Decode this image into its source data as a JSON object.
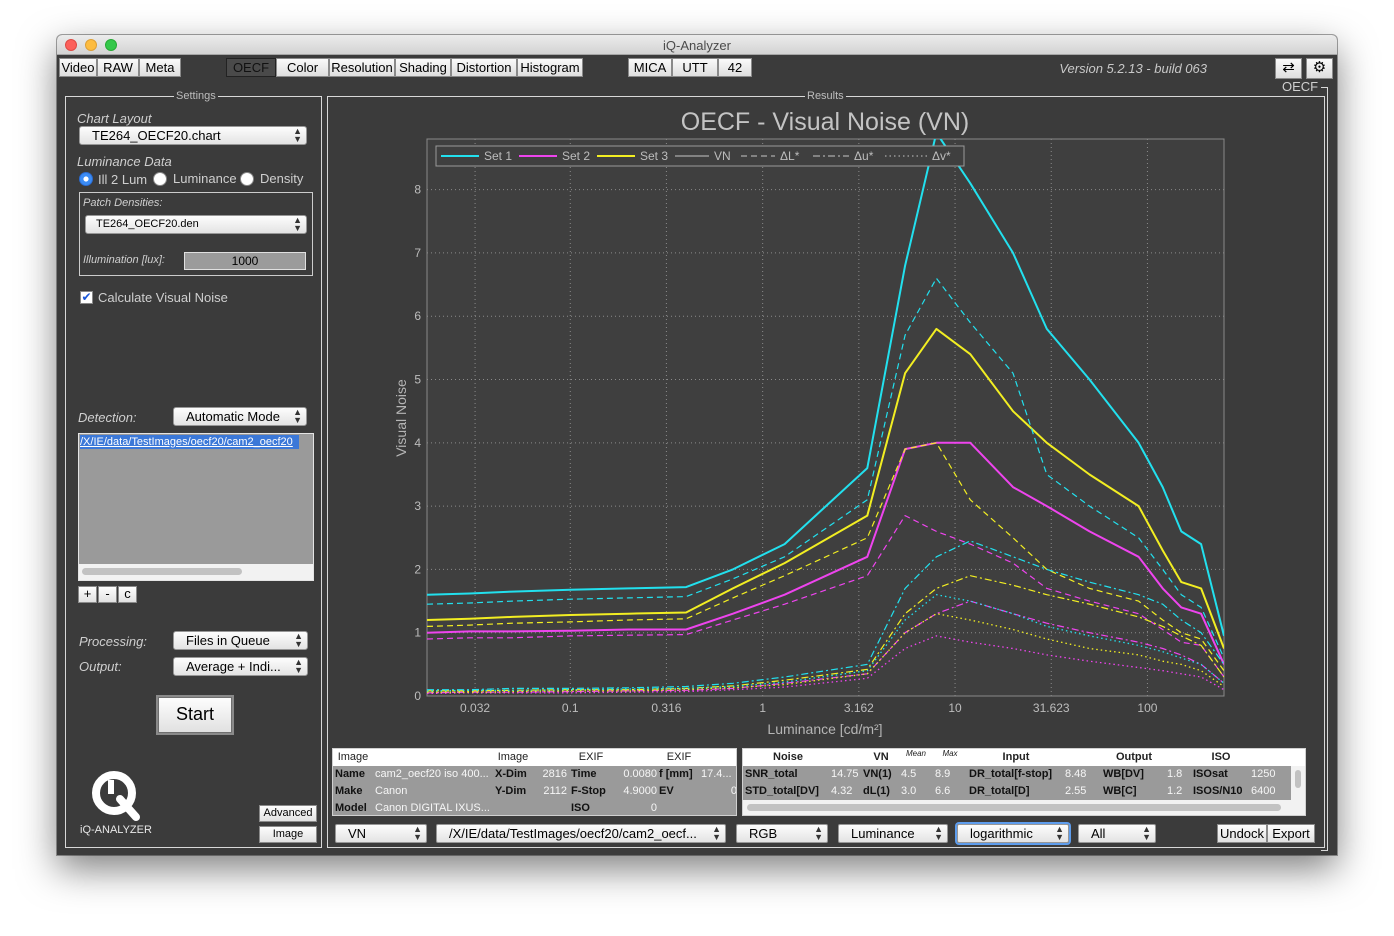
{
  "window": {
    "title": "iQ-Analyzer",
    "version": "Version 5.2.13 - build 063"
  },
  "toolbar": {
    "left_tabs": [
      "Video",
      "RAW",
      "Meta"
    ],
    "mode_tabs": [
      "OECF",
      "Color",
      "Resolution",
      "Shading",
      "Distortion",
      "Histogram"
    ],
    "extra_tabs": [
      "MICA",
      "UTT",
      "42"
    ],
    "active_tab": "OECF",
    "swap_icon": "swap-arrows-icon",
    "settings_icon": "gear-icon"
  },
  "settings": {
    "panel_title": "Settings",
    "chart_layout_label": "Chart Layout",
    "chart_layout_value": "TE264_OECF20.chart",
    "luminance_data_label": "Luminance Data",
    "radio_options": [
      "Ill 2 Lum",
      "Luminance",
      "Density"
    ],
    "radio_selected": "Ill 2 Lum",
    "patch_densities_label": "Patch Densities:",
    "patch_densities_value": "TE264_OECF20.den",
    "illumination_label": "Illumination [lux]:",
    "illumination_value": "1000",
    "calc_visual_noise_label": "Calculate Visual Noise",
    "calc_visual_noise_checked": true,
    "detection_label": "Detection:",
    "detection_value": "Automatic Mode",
    "file_list": [
      "/X/IE/data/TestImages/oecf20/cam2_oecf20"
    ],
    "list_buttons": [
      "+",
      "-",
      "c"
    ],
    "processing_label": "Processing:",
    "processing_value": "Files in Queue",
    "output_label": "Output:",
    "output_value": "Average + Indi...",
    "start_label": "Start",
    "logo_text": "iQ-ANALYZER",
    "advanced_label": "Advanced",
    "image_label": "Image"
  },
  "results": {
    "panel_title": "Results",
    "section_label": "OECF",
    "undock_label": "Undock",
    "export_label": "Export",
    "bottom_selects": [
      "VN",
      "/X/IE/data/TestImages/oecf20/cam2_oecf...",
      "RGB",
      "Luminance",
      "logarithmic",
      "All"
    ]
  },
  "image_table": {
    "headers": [
      "Image",
      "Image",
      "EXIF",
      "EXIF"
    ],
    "rows": [
      [
        "Name",
        "cam2_oecf20 iso 400...",
        "X-Dim",
        "2816",
        "Time",
        "0.0080",
        "f [mm]",
        "17.4..."
      ],
      [
        "Make",
        "Canon",
        "Y-Dim",
        "2112",
        "F-Stop",
        "4.9000",
        "EV",
        "0"
      ],
      [
        "Model",
        "Canon DIGITAL IXUS...",
        "",
        "",
        "ISO",
        "0",
        "",
        ""
      ]
    ]
  },
  "noise_table": {
    "headers": [
      "Noise",
      "VN",
      "Mean",
      "Max",
      "Input",
      "Output",
      "ISO"
    ],
    "rows": [
      [
        "SNR_total",
        "14.75",
        "VN(1)",
        "4.5",
        "8.9",
        "DR_total[f-stop]",
        "8.48",
        "WB[DV]",
        "1.8",
        "ISOsat",
        "1250"
      ],
      [
        "STD_total[DV]",
        "4.32",
        "dL(1)",
        "3.0",
        "6.6",
        "DR_total[D]",
        "2.55",
        "WB[C]",
        "1.2",
        "ISOS/N10",
        "6400"
      ]
    ]
  },
  "colors": {
    "set1": "#22e0ee",
    "set2": "#ee44ee",
    "set3": "#f2ee22",
    "plot_bg": "#3f3f3f",
    "axis_text": "#bdbdbd",
    "title": "#c4c4c4"
  },
  "chart_data": {
    "type": "line",
    "title": "OECF - Visual Noise (VN)",
    "xlabel": "Luminance [cd/m²]",
    "ylabel": "Visual Noise",
    "xscale": "log",
    "xlim": [
      0.018,
      250
    ],
    "ylim": [
      0,
      8.8
    ],
    "xticks": [
      0.032,
      0.1,
      0.316,
      1,
      3.162,
      10,
      31.623,
      100
    ],
    "xtick_labels": [
      "0.032",
      "0.1",
      "0.316",
      "1",
      "3.162",
      "10",
      "31.623",
      "100"
    ],
    "yticks": [
      0,
      1,
      2,
      3,
      4,
      5,
      6,
      7,
      8
    ],
    "grid": true,
    "legend_position": "top-left",
    "legend": [
      {
        "label": "Set 1",
        "style": "solid",
        "color": "#22e0ee"
      },
      {
        "label": "Set 2",
        "style": "solid",
        "color": "#ee44ee"
      },
      {
        "label": "Set 3",
        "style": "solid",
        "color": "#f2ee22"
      },
      {
        "label": "VN",
        "style": "solid",
        "color": "#aaaaaa"
      },
      {
        "label": "ΔL*",
        "style": "dash",
        "color": "#aaaaaa"
      },
      {
        "label": "Δu*",
        "style": "dashdot",
        "color": "#aaaaaa"
      },
      {
        "label": "Δv*",
        "style": "dot",
        "color": "#aaaaaa"
      }
    ],
    "x": [
      0.018,
      0.03,
      0.05,
      0.1,
      0.2,
      0.4,
      0.7,
      1.3,
      3.5,
      5.5,
      8,
      12,
      20,
      30,
      50,
      90,
      120,
      150,
      190,
      250
    ],
    "series": [
      {
        "name": "Set 1",
        "metric": "VN",
        "style": "solid",
        "color": "#22e0ee",
        "values": [
          1.6,
          1.62,
          1.65,
          1.68,
          1.7,
          1.72,
          2.0,
          2.4,
          3.6,
          6.8,
          8.9,
          8.1,
          7.0,
          5.8,
          5.0,
          4.0,
          3.3,
          2.6,
          2.4,
          0.95
        ]
      },
      {
        "name": "Set 2",
        "metric": "VN",
        "style": "solid",
        "color": "#ee44ee",
        "values": [
          1.0,
          1.02,
          1.02,
          1.03,
          1.05,
          1.05,
          1.3,
          1.6,
          2.2,
          3.9,
          4.0,
          4.0,
          3.3,
          3.0,
          2.6,
          2.2,
          1.7,
          1.4,
          1.3,
          0.5
        ]
      },
      {
        "name": "Set 3",
        "metric": "VN",
        "style": "solid",
        "color": "#f2ee22",
        "values": [
          1.2,
          1.22,
          1.25,
          1.28,
          1.3,
          1.32,
          1.7,
          2.1,
          2.85,
          5.1,
          5.8,
          5.4,
          4.5,
          4.0,
          3.5,
          3.0,
          2.3,
          1.8,
          1.7,
          0.75
        ]
      },
      {
        "name": "Set 1",
        "metric": "ΔL*",
        "style": "dash",
        "color": "#22e0ee",
        "values": [
          1.45,
          1.47,
          1.5,
          1.53,
          1.55,
          1.57,
          1.85,
          2.2,
          3.1,
          5.7,
          6.6,
          5.9,
          5.1,
          3.5,
          3.0,
          2.5,
          2.0,
          1.6,
          1.4,
          0.6
        ]
      },
      {
        "name": "Set 2",
        "metric": "ΔL*",
        "style": "dash",
        "color": "#ee44ee",
        "values": [
          0.9,
          0.92,
          0.92,
          0.95,
          0.96,
          0.97,
          1.2,
          1.45,
          1.9,
          2.85,
          2.6,
          2.4,
          2.1,
          1.7,
          1.5,
          1.3,
          1.05,
          0.85,
          0.8,
          0.3
        ]
      },
      {
        "name": "Set 3",
        "metric": "ΔL*",
        "style": "dash",
        "color": "#f2ee22",
        "values": [
          1.1,
          1.12,
          1.15,
          1.17,
          1.2,
          1.22,
          1.55,
          1.9,
          2.5,
          3.9,
          4.0,
          3.1,
          2.5,
          2.0,
          1.7,
          1.5,
          1.2,
          1.0,
          0.9,
          0.4
        ]
      },
      {
        "name": "Set 1",
        "metric": "Δu*",
        "style": "dashdot",
        "color": "#22e0ee",
        "values": [
          0.1,
          0.1,
          0.12,
          0.12,
          0.13,
          0.15,
          0.2,
          0.3,
          0.5,
          1.7,
          2.2,
          2.45,
          2.2,
          2.0,
          1.8,
          1.6,
          1.45,
          1.2,
          1.0,
          0.5
        ]
      },
      {
        "name": "Set 2",
        "metric": "Δu*",
        "style": "dashdot",
        "color": "#ee44ee",
        "values": [
          0.05,
          0.06,
          0.06,
          0.07,
          0.08,
          0.09,
          0.12,
          0.2,
          0.35,
          1.0,
          1.3,
          1.5,
          1.3,
          1.15,
          1.0,
          0.85,
          0.75,
          0.65,
          0.5,
          0.2
        ]
      },
      {
        "name": "Set 3",
        "metric": "Δu*",
        "style": "dashdot",
        "color": "#f2ee22",
        "values": [
          0.08,
          0.08,
          0.09,
          0.1,
          0.1,
          0.12,
          0.16,
          0.25,
          0.42,
          1.3,
          1.7,
          1.9,
          1.75,
          1.6,
          1.45,
          1.25,
          1.1,
          0.95,
          0.8,
          0.3
        ]
      },
      {
        "name": "Set 1",
        "metric": "Δv*",
        "style": "dot",
        "color": "#22e0ee",
        "values": [
          0.08,
          0.09,
          0.09,
          0.1,
          0.11,
          0.12,
          0.15,
          0.22,
          0.4,
          1.2,
          1.6,
          1.5,
          1.3,
          1.1,
          0.95,
          0.8,
          0.7,
          0.6,
          0.5,
          0.2
        ]
      },
      {
        "name": "Set 2",
        "metric": "Δv*",
        "style": "dot",
        "color": "#ee44ee",
        "values": [
          0.04,
          0.05,
          0.05,
          0.05,
          0.06,
          0.07,
          0.1,
          0.14,
          0.28,
          0.75,
          0.95,
          0.85,
          0.75,
          0.65,
          0.55,
          0.45,
          0.4,
          0.35,
          0.3,
          0.1
        ]
      },
      {
        "name": "Set 3",
        "metric": "Δv*",
        "style": "dot",
        "color": "#f2ee22",
        "values": [
          0.06,
          0.06,
          0.07,
          0.08,
          0.08,
          0.1,
          0.13,
          0.18,
          0.35,
          1.0,
          1.3,
          1.2,
          1.05,
          0.9,
          0.75,
          0.65,
          0.55,
          0.5,
          0.4,
          0.15
        ]
      }
    ]
  }
}
